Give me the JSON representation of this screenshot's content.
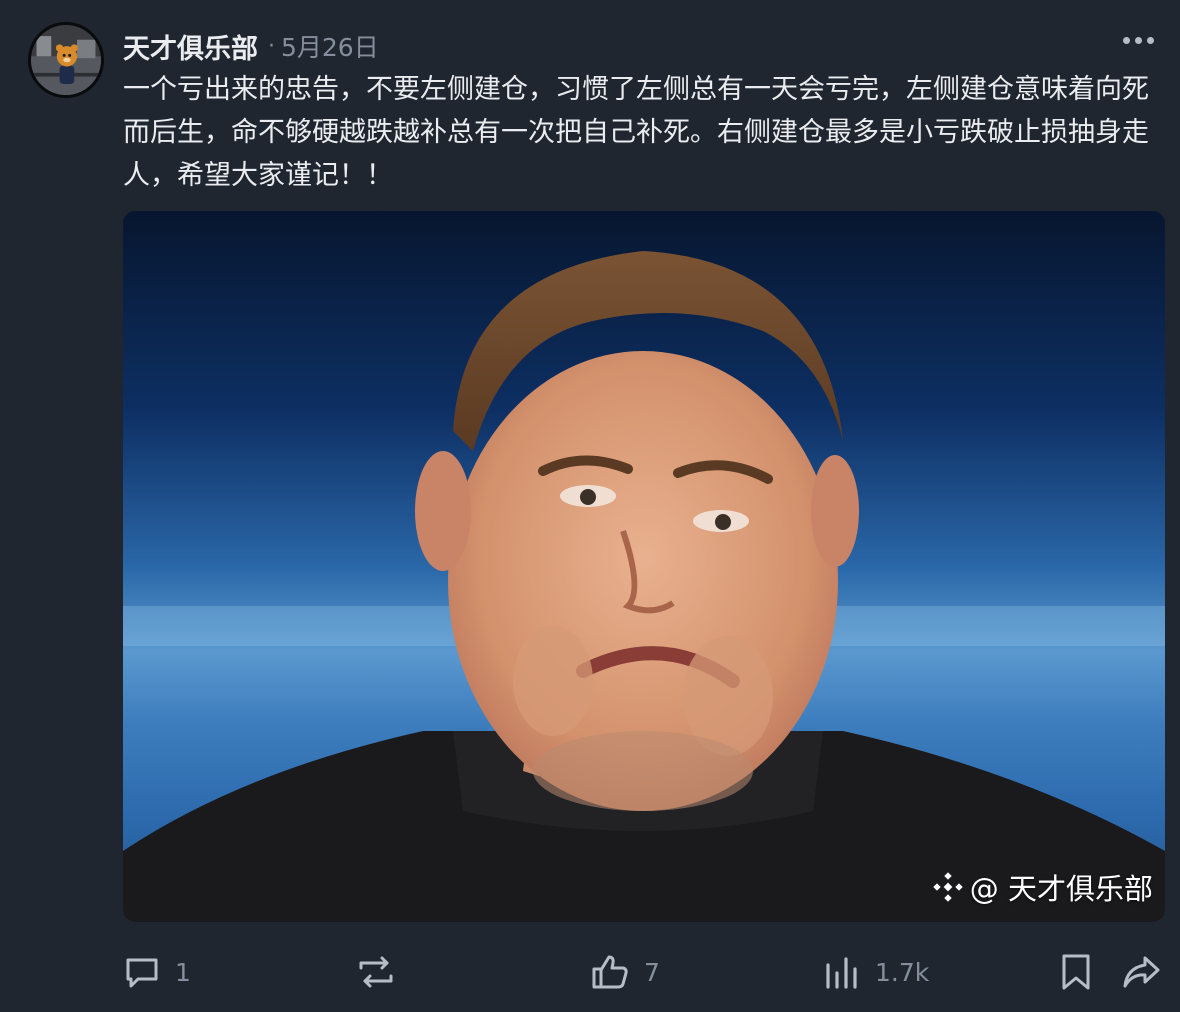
{
  "post": {
    "author": {
      "name": "天才俱乐部"
    },
    "separator": "·",
    "date": "5月26日",
    "content": "一个亏出来的忠告，不要左侧建仓，习惯了左侧总有一天会亏完，左侧建仓意味着向死而后生，命不够硬越跌越补总有一次把自己补死。右侧建仓最多是小亏跌破止损抽身走人，希望大家谨记！！",
    "image": {
      "watermark": "@ 天才俱乐部"
    },
    "stats": {
      "comments": "1",
      "likes": "7",
      "views": "1.7k"
    }
  },
  "theme": {
    "background": "#1f2630",
    "text_primary": "#eaecef",
    "text_secondary": "#848e9c",
    "icon_color": "#b7bdc6"
  },
  "icons": {
    "more": "more-horizontal-icon",
    "comment": "comment-bubble-icon",
    "repost": "repost-arrows-icon",
    "like": "thumbs-up-icon",
    "views": "bar-chart-icon",
    "bookmark": "bookmark-icon",
    "share": "share-arrow-icon",
    "watermark_logo": "binance-diamond-logo-icon"
  }
}
